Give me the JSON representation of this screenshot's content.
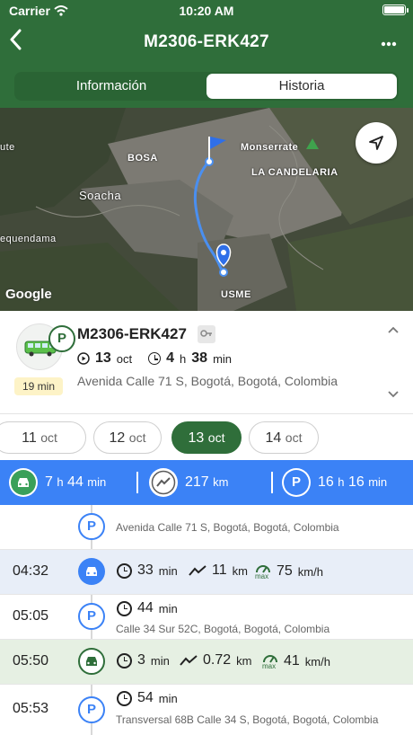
{
  "status_bar": {
    "carrier": "Carrier",
    "time": "10:20 AM"
  },
  "header": {
    "title": "M2306-ERK427",
    "back_icon": "back-chevron-icon",
    "more_icon": "more-dots-icon"
  },
  "tabs": [
    {
      "label": "Información",
      "active": false
    },
    {
      "label": "Historia",
      "active": true
    }
  ],
  "map": {
    "labels": [
      "BOSA",
      "Monserrate",
      "LA CANDELARIA",
      "Soacha",
      "equendama",
      "USME",
      "ute"
    ],
    "watermark": "Google",
    "route_color": "#4a8ff0"
  },
  "vehicle_card": {
    "plate": "M2306-ERK427",
    "parking_badge": "P",
    "duration_badge": "19 min",
    "day": "13",
    "month": "oct",
    "hours": "4",
    "hours_unit": "h",
    "minutes": "38",
    "minutes_unit": "min",
    "address": "Avenida Calle 71 S, Bogotá, Bogotá, Colombia"
  },
  "dates": [
    {
      "day": "11",
      "month": "oct",
      "selected": false
    },
    {
      "day": "12",
      "month": "oct",
      "selected": false
    },
    {
      "day": "13",
      "month": "oct",
      "selected": true
    },
    {
      "day": "14",
      "month": "oct",
      "selected": false
    }
  ],
  "summary": {
    "drive_hours": "7",
    "drive_hours_unit": "h",
    "drive_minutes": "44",
    "drive_minutes_unit": "min",
    "distance": "217",
    "distance_unit": "km",
    "park_hours": "16",
    "park_hours_unit": "h",
    "park_minutes": "16",
    "park_minutes_unit": "min",
    "parking_letter": "P"
  },
  "timeline": {
    "row0": {
      "letter": "P",
      "address": "Avenida Calle 71 S, Bogotá, Bogotá, Colombia"
    },
    "row1": {
      "time": "04:32",
      "duration": "33",
      "duration_unit": "min",
      "distance": "11",
      "distance_unit": "km",
      "speed": "75",
      "speed_unit": "km/h",
      "speed_label": "max"
    },
    "row2": {
      "time": "05:05",
      "letter": "P",
      "duration": "44",
      "duration_unit": "min",
      "address": "Calle 34 Sur 52C, Bogotá, Bogotá, Colombia"
    },
    "row3": {
      "time": "05:50",
      "duration": "3",
      "duration_unit": "min",
      "distance": "0.72",
      "distance_unit": "km",
      "speed": "41",
      "speed_unit": "km/h",
      "speed_label": "max"
    },
    "row4": {
      "time": "05:53",
      "letter": "P",
      "duration": "54",
      "duration_unit": "min",
      "address": "Transversal 68B Calle 34 S, Bogotá, Bogotá, Colombia"
    }
  },
  "colors": {
    "header_green": "#2f6e3a",
    "summary_blue": "#3b82f6",
    "drive_row_blue": "#e8eef8",
    "drive_row_green": "#e6f0e3"
  }
}
